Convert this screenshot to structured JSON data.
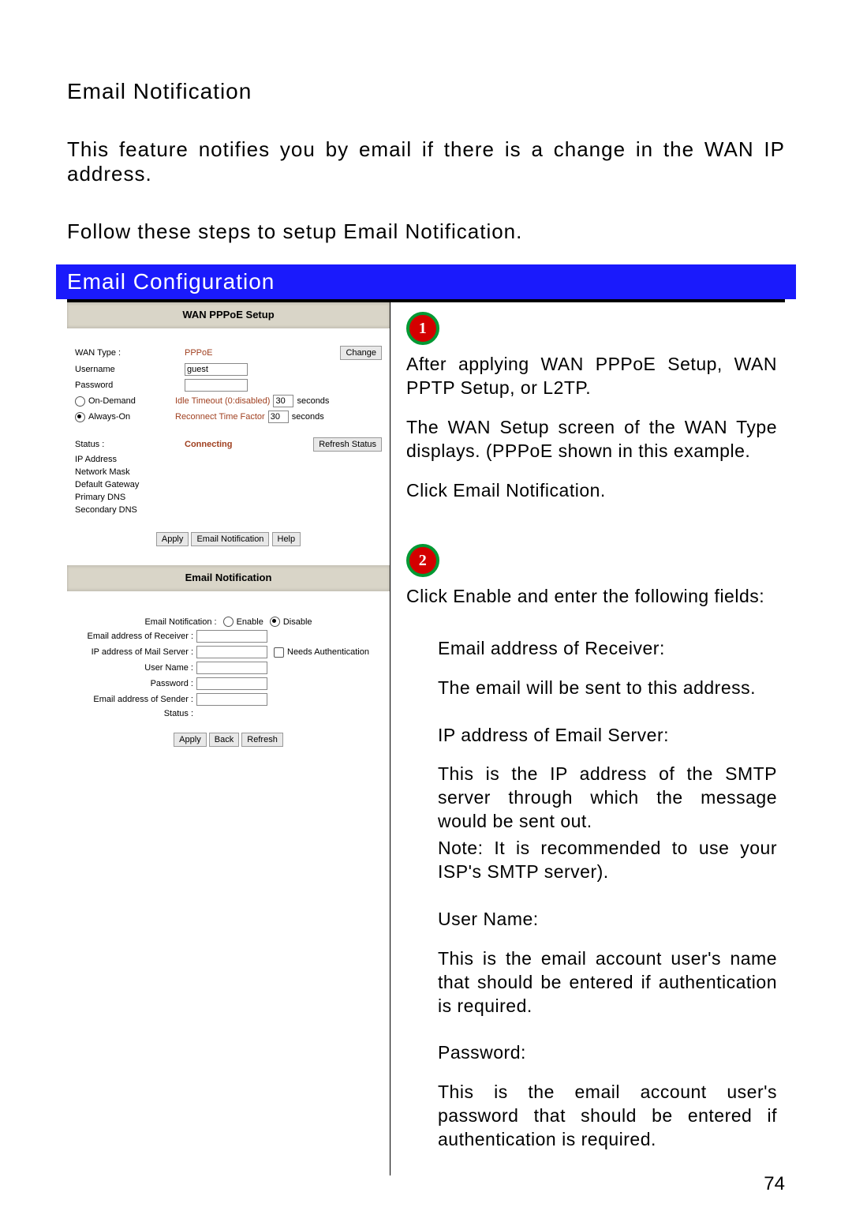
{
  "page_number": "74",
  "heading": "Email Notification",
  "intro_text": "This feature notifies you by email if there is a change in the WAN IP address.",
  "follow_text": "Follow these steps to setup Email Notification.",
  "banner": "Email Configuration",
  "panel_wan": {
    "title": "WAN PPPoE Setup",
    "labels": {
      "wan_type": "WAN Type :",
      "username": "Username",
      "password": "Password",
      "ondemand": "On-Demand",
      "always": "Always-On",
      "idle": "Idle Timeout (0:disabled)",
      "reconnect": "Reconnect Time Factor",
      "seconds": "seconds",
      "status": "Status :",
      "ip": "IP Address",
      "mask": "Network Mask",
      "gateway": "Default Gateway",
      "pdns": "Primary DNS",
      "sdns": "Secondary DNS"
    },
    "values": {
      "wan_type": "PPPoE",
      "username": "guest",
      "idle": "30",
      "reconnect": "30",
      "status": "Connecting"
    },
    "buttons": {
      "change": "Change",
      "refresh": "Refresh Status",
      "apply": "Apply",
      "email": "Email Notification",
      "help": "Help"
    }
  },
  "panel_email": {
    "title": "Email Notification",
    "toggle_label": "Email Notification :",
    "enable": "Enable",
    "disable": "Disable",
    "labels": {
      "receiver": "Email address of Receiver :",
      "server": "IP address of Mail Server :",
      "auth": "Needs Authentication",
      "user": "User Name :",
      "password": "Password :",
      "sender": "Email address of Sender :",
      "status": "Status :"
    },
    "buttons": {
      "apply": "Apply",
      "back": "Back",
      "refresh": "Refresh"
    }
  },
  "steps": {
    "1": {
      "p1": "After applying WAN PPPoE Setup, WAN PPTP Setup, or L2TP.",
      "p2": "The WAN Setup screen of the WAN Type displays. (PPPoE shown in this example.",
      "p3": "Click Email Notification."
    },
    "2": {
      "p1": "Click Enable and enter the following fields:",
      "receiver_h": "Email address of Receiver:",
      "receiver_b": "The email will be sent to this address.",
      "server_h": "IP address of Email Server:",
      "server_b": "This is the IP address of the SMTP server through which the message would be sent out.",
      "server_n": "Note: It is recommended to use your ISP's SMTP server).",
      "user_h": "User Name:",
      "user_b": "This is the email account user's name that should be entered if authentication is required.",
      "pass_h": "Password:",
      "pass_b": "This is the email account user's password that should be entered if authentication is required."
    }
  }
}
